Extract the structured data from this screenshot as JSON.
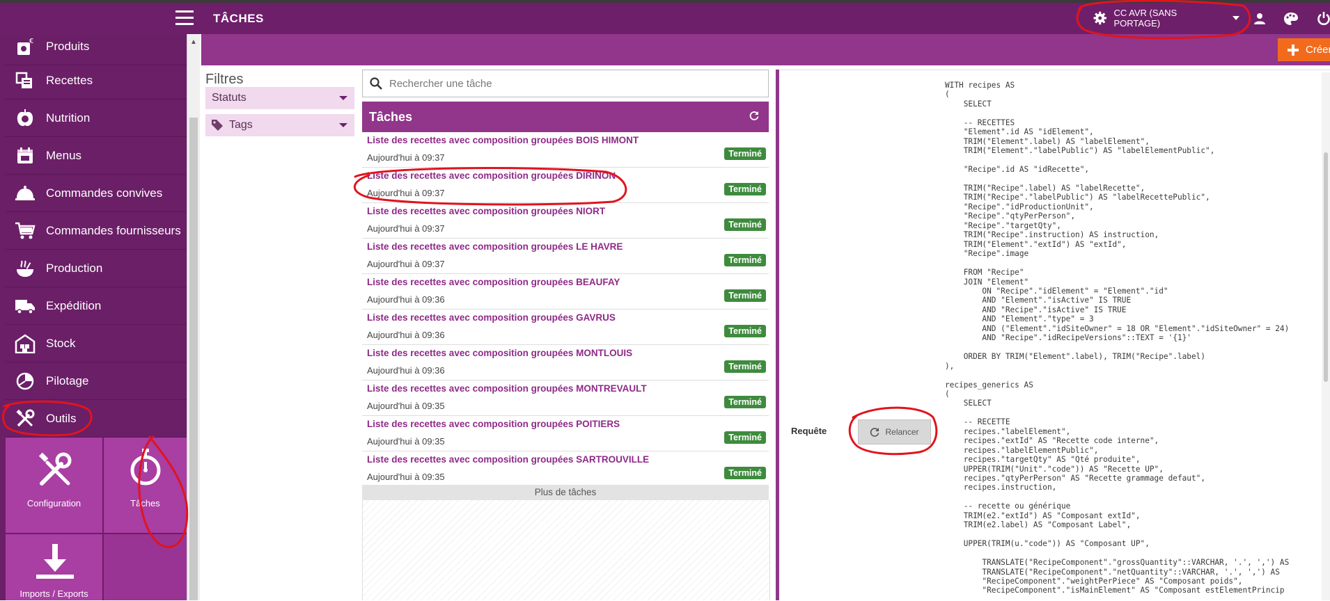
{
  "topbar": {
    "title": "TÂCHES",
    "site_selector": "CC AVR (SANS PORTAGE)"
  },
  "sidebar": {
    "items": [
      {
        "label": "Produits",
        "icon": "products-icon"
      },
      {
        "label": "Recettes",
        "icon": "recipes-icon"
      },
      {
        "label": "Nutrition",
        "icon": "nutrition-icon"
      },
      {
        "label": "Menus",
        "icon": "menus-icon"
      },
      {
        "label": "Commandes convives",
        "icon": "bell-icon"
      },
      {
        "label": "Commandes fournisseurs",
        "icon": "cart-icon"
      },
      {
        "label": "Production",
        "icon": "cooking-pot-icon"
      },
      {
        "label": "Expédition",
        "icon": "truck-icon"
      },
      {
        "label": "Stock",
        "icon": "warehouse-icon"
      },
      {
        "label": "Pilotage",
        "icon": "pie-chart-icon"
      },
      {
        "label": "Outils",
        "icon": "tools-icon"
      }
    ],
    "tiles": [
      {
        "label": "Configuration",
        "icon": "wrench-screwdriver-icon"
      },
      {
        "label": "Tâches",
        "icon": "stopwatch-icon"
      },
      {
        "label": "Imports / Exports",
        "icon": "download-icon"
      }
    ]
  },
  "actionbar": {
    "create_label": "Créer"
  },
  "filters": {
    "title": "Filtres",
    "statut_label": "Statuts",
    "tags_label": "Tags"
  },
  "search": {
    "placeholder": "Rechercher une tâche"
  },
  "tasks": {
    "header": "Tâches",
    "more_label": "Plus de tâches",
    "items": [
      {
        "title": "Liste des recettes avec composition groupées BOIS HIMONT",
        "date": "Aujourd'hui à 09:37",
        "status": "Terminé"
      },
      {
        "title": "Liste des recettes avec composition groupées DIRINON",
        "date": "Aujourd'hui à 09:37",
        "status": "Terminé"
      },
      {
        "title": "Liste des recettes avec composition groupées NIORT",
        "date": "Aujourd'hui à 09:37",
        "status": "Terminé"
      },
      {
        "title": "Liste des recettes avec composition groupées LE HAVRE",
        "date": "Aujourd'hui à 09:37",
        "status": "Terminé"
      },
      {
        "title": "Liste des recettes avec composition groupées BEAUFAY",
        "date": "Aujourd'hui à 09:36",
        "status": "Terminé"
      },
      {
        "title": "Liste des recettes avec composition groupées GAVRUS",
        "date": "Aujourd'hui à 09:36",
        "status": "Terminé"
      },
      {
        "title": "Liste des recettes avec composition groupées MONTLOUIS",
        "date": "Aujourd'hui à 09:36",
        "status": "Terminé"
      },
      {
        "title": "Liste des recettes avec composition groupées MONTREVAULT",
        "date": "Aujourd'hui à 09:35",
        "status": "Terminé"
      },
      {
        "title": "Liste des recettes avec composition groupées POITIERS",
        "date": "Aujourd'hui à 09:35",
        "status": "Terminé"
      },
      {
        "title": "Liste des recettes avec composition groupées SARTROUVILLE",
        "date": "Aujourd'hui à 09:35",
        "status": "Terminé"
      }
    ]
  },
  "detail": {
    "request_label": "Requête",
    "relaunch_label": "Relancer",
    "sql": "WITH recipes AS\n(\n    SELECT\n\n    -- RECETTES\n    \"Element\".id AS \"idElement\",\n    TRIM(\"Element\".label) AS \"labelElement\",\n    TRIM(\"Element\".\"labelPublic\") AS \"labelElementPublic\",\n\n    \"Recipe\".id AS \"idRecette\",\n\n    TRIM(\"Recipe\".label) AS \"labelRecette\",\n    TRIM(\"Recipe\".\"labelPublic\") AS \"labelRecettePublic\",\n    \"Recipe\".\"idProductionUnit\",\n    \"Recipe\".\"qtyPerPerson\",\n    \"Recipe\".\"targetQty\",\n    TRIM(\"Recipe\".instruction) AS instruction,\n    TRIM(\"Element\".\"extId\") AS \"extId\",\n    \"Recipe\".image\n\n    FROM \"Recipe\"\n    JOIN \"Element\"\n        ON \"Recipe\".\"idElement\" = \"Element\".\"id\"\n        AND \"Element\".\"isActive\" IS TRUE\n        AND \"Recipe\".\"isActive\" IS TRUE\n        AND \"Element\".\"type\" = 3\n        AND (\"Element\".\"idSiteOwner\" = 18 OR \"Element\".\"idSiteOwner\" = 24)\n        AND \"Recipe\".\"idRecipeVersions\"::TEXT = '{1}'\n\n    ORDER BY TRIM(\"Element\".label), TRIM(\"Recipe\".label)\n),\n\nrecipes_generics AS\n(\n    SELECT\n\n    -- RECETTE\n    recipes.\"labelElement\",\n    recipes.\"extId\" AS \"Recette code interne\",\n    recipes.\"labelElementPublic\",\n    recipes.\"targetQty\" AS \"Qté produite\",\n    UPPER(TRIM(\"Unit\".\"code\")) AS \"Recette UP\",\n    recipes.\"qtyPerPerson\" AS \"Recette grammage defaut\",\n    recipes.instruction,\n\n    -- recette ou générique\n    TRIM(e2.\"extId\") AS \"Composant extId\",\n    TRIM(e2.label) AS \"Composant Label\",\n\n    UPPER(TRIM(u.\"code\")) AS \"Composant UP\",\n\n        TRANSLATE(\"RecipeComponent\".\"grossQuantity\"::VARCHAR, '.', ',') AS\n        TRANSLATE(\"RecipeComponent\".\"netQuantity\"::VARCHAR, '.', ',') AS\n        \"RecipeComponent\".\"weightPerPiece\" AS \"Composant poids\",\n        \"RecipeComponent\".\"isMainElement\" AS \"Composant estElementPrincip"
  }
}
